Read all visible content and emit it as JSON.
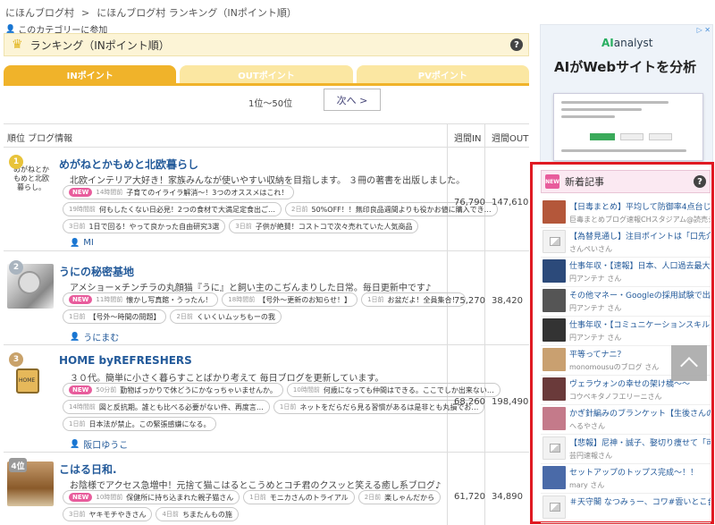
{
  "breadcrumb": {
    "home": "にほんブログ村",
    "sep": ">",
    "current": "にほんブログ村 ランキング（INポイント順）"
  },
  "category_join": "このカテゴリーに参加",
  "ranking": {
    "title": "ランキング（INポイント順）",
    "help": "?"
  },
  "tabs": [
    {
      "label": "INポイント",
      "active": true
    },
    {
      "label": "OUTポイント",
      "active": false
    },
    {
      "label": "PVポイント",
      "active": false
    }
  ],
  "pager": {
    "range": "1位〜50位",
    "next": "次へ >"
  },
  "table": {
    "col_rank": "順位 ブログ情報",
    "col_in": "週間IN",
    "col_out": "週間OUT"
  },
  "entries": [
    {
      "rank": "1",
      "thumb_text": "めがねとかもめと北欧暮らし。",
      "title": "めがねとかもめと北欧暮らし",
      "desc": "北欧インテリア大好き！家族みんなが使いやすい収納を目指します。 ３冊の著書を出版しました。",
      "posts": [
        [
          {
            "new": "NEW",
            "time": "14時間前",
            "text": "子育てのイライラ解消～！3つのオススメはこれ！"
          }
        ],
        [
          {
            "time": "19時間前",
            "text": "何もしたくない日必見！2つの食材で大満足定食出ご…"
          },
          {
            "time": "2日前",
            "text": "50%OFF！！無印良品週間よりも役かお値に購入でき…"
          }
        ],
        [
          {
            "time": "3日前",
            "text": "1日で回る！やって良かった自由研究3選"
          },
          {
            "time": "3日前",
            "text": "子供が絶賛！コストコで次々売れていた人気商品"
          }
        ]
      ],
      "author": "MI",
      "in": "76,790",
      "out": "147,610"
    },
    {
      "rank": "2",
      "title": "うにの秘密基地",
      "desc": "アメショー×チンチラの丸顔猫『うに』と飼い主のこぢんまりした日常。毎日更新中です♪",
      "posts": [
        [
          {
            "new": "NEW",
            "time": "11時間前",
            "text": "懐かし写真館・うったん！"
          },
          {
            "time": "18時間前",
            "text": "【号外～更新のお知らせ！】"
          },
          {
            "time": "1日前",
            "text": "お盆だよ！全員集合！"
          }
        ],
        [
          {
            "time": "1日前",
            "text": "【号外～時間の問題】"
          },
          {
            "time": "2日前",
            "text": "くいくいムッちもーの我"
          }
        ]
      ],
      "author": "うにまむ",
      "in": "75,270",
      "out": "38,420"
    },
    {
      "rank": "3",
      "thumb_text": "HOME",
      "title": "HOME byREFRESHERS",
      "desc": "３０代。簡単に小さく暮らすことばかり考えて 毎日ブログを更新しています。",
      "posts": [
        [
          {
            "new": "NEW",
            "time": "50分前",
            "text": "勤物ばっかりで休どうにかなっちゃいませんか。"
          },
          {
            "time": "10時間前",
            "text": "何歳になっても仲間はできる。ここでしか出来ない…"
          }
        ],
        [
          {
            "time": "14時間前",
            "text": "図と反抗期。誰とも比べる必要がない件、再度言…"
          },
          {
            "time": "1日前",
            "text": "ネットをだらだら見る習慣があるは是非とも丸損でお…"
          }
        ],
        [
          {
            "time": "1日前",
            "text": "日本法が禁止。この緊張感嫌になる。"
          }
        ]
      ],
      "author": "阪口ゆうこ",
      "in": "68,260",
      "out": "198,490"
    },
    {
      "rank": "4位",
      "title": "こはる日和.",
      "desc": "お陰様でアクセス急増中！元捨て猫こはるとこうめとコチ君のクスッと笑える癒し系ブログ♪",
      "posts": [
        [
          {
            "new": "NEW",
            "time": "10時間前",
            "text": "保健所に持ち込まれた親子猫さん"
          },
          {
            "time": "1日前",
            "text": "モニカさんのトライアル"
          },
          {
            "time": "2日前",
            "text": "楽しゃんだから"
          }
        ],
        [
          {
            "time": "3日前",
            "text": "ヤキモチやきさん"
          },
          {
            "time": "4日前",
            "text": "ちまたんもの施"
          }
        ]
      ],
      "author": "",
      "in": "61,720",
      "out": "34,890"
    }
  ],
  "ad": {
    "close": "▷ ✕",
    "logo_prefix": "AI",
    "logo_suffix": "analyst",
    "headline": "AIがWebサイトを分析"
  },
  "new_articles": {
    "title": "新着記事",
    "new_label": "NEW",
    "help": "?",
    "items": [
      {
        "title": "【日毒まとめ】平均して防御率4点台じゃな…",
        "source": "巨毒まとめブログ速報CHスタジアム@読売ジャイアンツ（巨人）さん",
        "thumb": "#b4573a"
      },
      {
        "title": "【為替見通し】注目ポイントは「口先介入…",
        "source": "さんぺいさん",
        "thumb": "noimg"
      },
      {
        "title": "仕事年収・【速報】日本、人口過去最大43…",
        "source": "円アンテナ さん",
        "thumb": "#2c4a7a"
      },
      {
        "title": "その他マネー・Googleの採用試験で出さ…",
        "source": "円アンテナ さん",
        "thumb": "#555555"
      },
      {
        "title": "仕事年収・【コミュニケーションスキル】…",
        "source": "円アンテナ さん",
        "thumb": "#333333"
      },
      {
        "title": "平等ってナニ？",
        "source": "monomousuのブログ さん",
        "thumb": "#c9a070"
      },
      {
        "title": "ヴェラウォンの幸せの架け橋～～",
        "source": "コウペキタノフエリーニさん",
        "thumb": "#6a3a3a"
      },
      {
        "title": "かぎ針編みのブランケット【生後さんの作…",
        "source": "へるやさん",
        "thumb": "#c47a8a"
      },
      {
        "title": "【悲報】尼神・誠子、娶切り痩せて「可愛…",
        "source": "芸円速報さん",
        "thumb": "noimg"
      },
      {
        "title": "セットアップのトップス完成～！！",
        "source": "mary さん",
        "thumb": "#4a6aa8"
      },
      {
        "title": "＃天守閣 なつみぅー、コワ#雲いとこ台…",
        "source": "",
        "thumb": "noimg"
      }
    ]
  }
}
